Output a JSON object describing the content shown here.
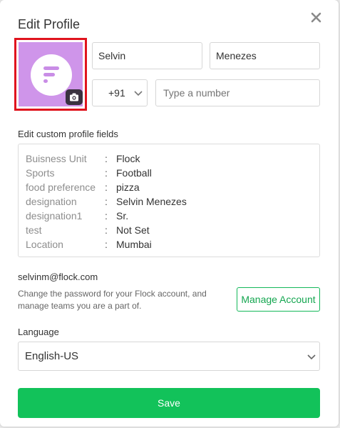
{
  "dialog": {
    "title": "Edit Profile",
    "close_icon": "close-icon"
  },
  "profile": {
    "avatar_icon": "flock-logo",
    "camera_icon": "camera-icon",
    "first_name": "Selvin",
    "last_name": "Menezes",
    "country_code": "+91",
    "phone_placeholder": "Type a number",
    "phone_value": ""
  },
  "custom_fields": {
    "heading": "Edit custom profile fields",
    "rows": [
      {
        "key": "Buisness Unit",
        "value": "Flock"
      },
      {
        "key": "Sports",
        "value": "Football"
      },
      {
        "key": "food preference",
        "value": "pizza"
      },
      {
        "key": "designation",
        "value": "Selvin Menezes"
      },
      {
        "key": "designation1",
        "value": "Sr."
      },
      {
        "key": "test",
        "value": "Not Set"
      },
      {
        "key": "Location",
        "value": "Mumbai"
      }
    ]
  },
  "account": {
    "email": "selvinm@flock.com",
    "help_text": "Change the password for your Flock account, and manage teams you are a part of.",
    "manage_button": "Manage Account"
  },
  "language": {
    "label": "Language",
    "selected": "English-US"
  },
  "footer": {
    "save_label": "Save"
  },
  "colors": {
    "accent_green": "#12c25a",
    "avatar_bg": "#cf95ea",
    "highlight_red": "#e0141e"
  }
}
